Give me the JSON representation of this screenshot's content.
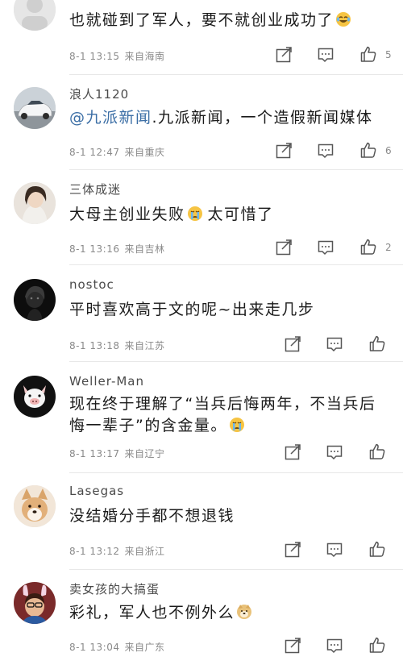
{
  "comments": [
    {
      "username": "",
      "text": "也就碰到了军人，要不就创业成功了",
      "text_emoji": "laugh-cry",
      "time": "8-1 13:15",
      "location": "来自海南",
      "likes": "5"
    },
    {
      "username": "浪人1120",
      "mention": "@九派新闻",
      "text": ".九派新闻，一个造假新闻媒体",
      "time": "8-1 12:47",
      "location": "来自重庆",
      "likes": "6"
    },
    {
      "username": "三体成迷",
      "text": "大母主创业失败",
      "text_emoji": "crying",
      "text_after": "太可惜了",
      "time": "8-1 13:16",
      "location": "来自吉林",
      "likes": "2"
    },
    {
      "username": "nostoc",
      "text": "平时喜欢高于文的呢~出来走几步",
      "time": "8-1 13:18",
      "location": "来自江苏",
      "likes": ""
    },
    {
      "username": "Weller-Man",
      "text_line1": "现在终于理解了“当兵后悔两年，不当兵后",
      "text_line2": "悔一辈子”的含金量。",
      "text_emoji": "crying",
      "time": "8-1 13:17",
      "location": "来自辽宁",
      "likes": ""
    },
    {
      "username": "Lasegas",
      "text": "没结婚分手都不想退钱",
      "time": "8-1 13:12",
      "location": "来自浙江",
      "likes": ""
    },
    {
      "username": "卖女孩的大搞蛋",
      "text": "彩礼，军人也不例外么",
      "text_emoji": "doge",
      "time": "8-1 13:04",
      "location": "来自广东",
      "likes": ""
    }
  ],
  "icons": {
    "share": "share-icon",
    "reply": "comment-icon",
    "like": "thumbs-up-icon"
  },
  "colors": {
    "mention": "#3b6ea5",
    "meta": "#8a8a8a",
    "separator": "#e8e8e8"
  }
}
